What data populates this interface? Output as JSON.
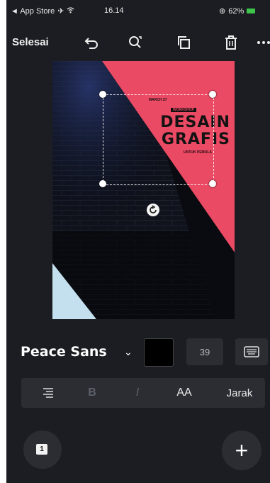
{
  "status_bar": {
    "carrier": "◄ App Store",
    "time": "16.14",
    "battery": "62%"
  },
  "toolbar": {
    "done_label": "Selesai",
    "icons": [
      "undo-icon",
      "search-icon",
      "copy-icon",
      "trash-icon",
      "more-icon"
    ]
  },
  "poster": {
    "small_top": "MARCH 27",
    "label_workshop": "WORKSHOP",
    "title_line1": "DESAIN",
    "title_line2": "GRAFIS",
    "subtitle": "UNTUK PEMULA",
    "colors": {
      "red": "#ea4a63",
      "light_blue": "#c4e0ef",
      "navy": "#152047"
    }
  },
  "text_tools": {
    "font_name": "Peace Sans",
    "font_chevron": "⌄",
    "font_size": "39",
    "text_color": "#000000",
    "keyboard_icon": "keyboard-icon",
    "format_buttons": {
      "align": "align-right-icon",
      "bold": "B",
      "italic": "I",
      "case": "AA",
      "spacing": "Jarak"
    }
  },
  "bottom": {
    "page_count": "1",
    "add_label": "+"
  }
}
